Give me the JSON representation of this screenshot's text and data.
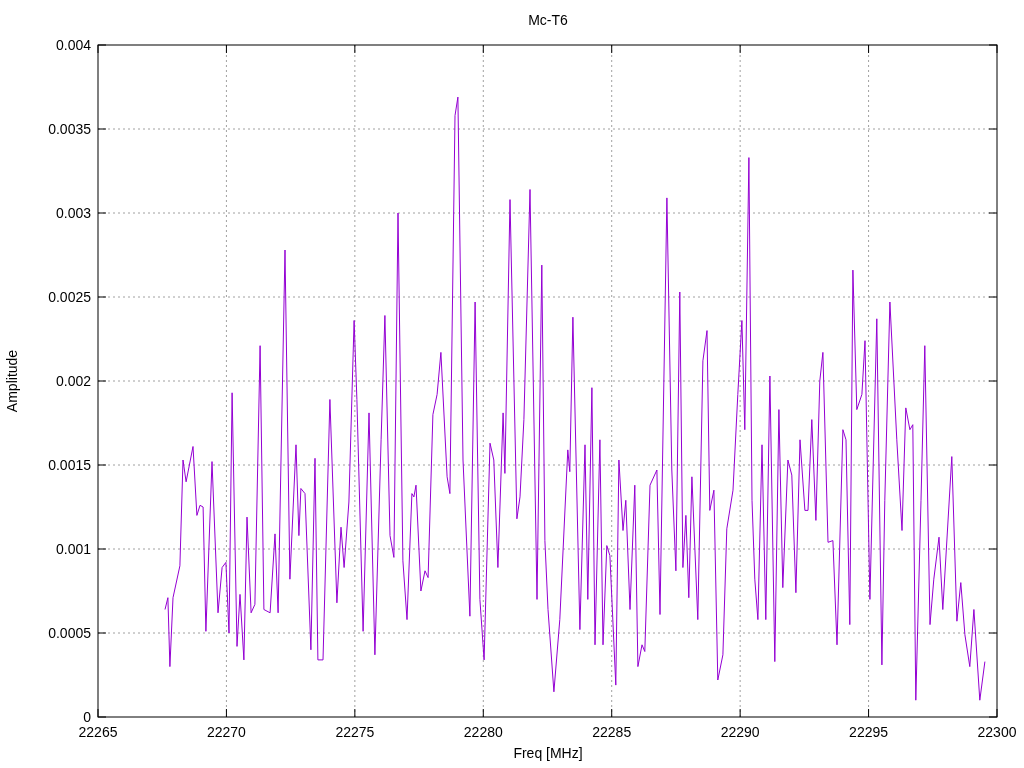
{
  "chart_data": {
    "type": "line",
    "grid": true,
    "title": "Mc-T6",
    "xlabel": "Freq [MHz]",
    "ylabel": "Amplitude",
    "xlim": [
      22265,
      22300
    ],
    "ylim": [
      0,
      0.004
    ],
    "xticks": [
      22265,
      22270,
      22275,
      22280,
      22285,
      22290,
      22295,
      22300
    ],
    "yticks": [
      0,
      0.0005,
      0.001,
      0.0015,
      0.002,
      0.0025,
      0.003,
      0.0035,
      0.004
    ],
    "x": [
      22267.61,
      22267.72,
      22267.8,
      22267.92,
      22268.19,
      22268.31,
      22268.43,
      22268.7,
      22268.85,
      22268.97,
      22269.09,
      22269.2,
      22269.44,
      22269.67,
      22269.83,
      22269.98,
      22270.1,
      22270.22,
      22270.41,
      22270.53,
      22270.68,
      22270.8,
      22270.96,
      22271.11,
      22271.31,
      22271.46,
      22271.7,
      22271.89,
      22272.01,
      22272.28,
      22272.47,
      22272.71,
      22272.82,
      22272.9,
      22273.06,
      22273.29,
      22273.45,
      22273.56,
      22273.76,
      22274.03,
      22274.3,
      22274.46,
      22274.58,
      22274.77,
      22274.97,
      22275.08,
      22275.32,
      22275.55,
      22275.78,
      22276.02,
      22276.17,
      22276.37,
      22276.52,
      22276.68,
      22276.87,
      22277.03,
      22277.22,
      22277.3,
      22277.38,
      22277.57,
      22277.73,
      22277.85,
      22278.04,
      22278.2,
      22278.35,
      22278.59,
      22278.7,
      22278.9,
      22279.01,
      22279.21,
      22279.48,
      22279.68,
      22279.87,
      22280.03,
      22280.26,
      22280.41,
      22280.57,
      22280.77,
      22280.84,
      22281.04,
      22281.31,
      22281.43,
      22281.58,
      22281.82,
      22282.09,
      22282.28,
      22282.4,
      22282.52,
      22282.75,
      22282.98,
      22283.29,
      22283.37,
      22283.49,
      22283.76,
      22283.96,
      22284.07,
      22284.23,
      22284.35,
      22284.54,
      22284.66,
      22284.81,
      22284.93,
      22285.16,
      22285.28,
      22285.44,
      22285.55,
      22285.71,
      22285.9,
      22286.02,
      22286.18,
      22286.29,
      22286.49,
      22286.76,
      22286.88,
      22287.15,
      22287.34,
      22287.5,
      22287.65,
      22287.77,
      22287.89,
      22288.0,
      22288.12,
      22288.35,
      22288.55,
      22288.71,
      22288.82,
      22288.98,
      22289.13,
      22289.33,
      22289.48,
      22289.72,
      22289.91,
      22290.07,
      22290.18,
      22290.34,
      22290.46,
      22290.57,
      22290.69,
      22290.85,
      22291.0,
      22291.16,
      22291.35,
      22291.51,
      22291.66,
      22291.86,
      22292.01,
      22292.17,
      22292.33,
      22292.52,
      22292.64,
      22292.79,
      22292.95,
      22293.1,
      22293.22,
      22293.42,
      22293.61,
      22293.77,
      22294.0,
      22294.12,
      22294.27,
      22294.39,
      22294.54,
      22294.74,
      22294.86,
      22295.05,
      22295.32,
      22295.52,
      22295.63,
      22295.83,
      22296.1,
      22296.3,
      22296.45,
      22296.61,
      22296.72,
      22296.84,
      22297.04,
      22297.19,
      22297.39,
      22297.54,
      22297.74,
      22297.89,
      22298.24,
      22298.44,
      22298.59,
      22298.75,
      22298.94,
      22299.1,
      22299.33,
      22299.53
    ],
    "series": [
      {
        "color": "#9400d3",
        "values": [
          0.00064,
          0.00071,
          0.0003,
          0.00071,
          0.0009,
          0.00153,
          0.0014,
          0.00161,
          0.0012,
          0.00126,
          0.00125,
          0.00051,
          0.00152,
          0.00062,
          0.00089,
          0.00092,
          0.0005,
          0.00193,
          0.00042,
          0.00073,
          0.00034,
          0.00119,
          0.00062,
          0.00067,
          0.00221,
          0.00064,
          0.00062,
          0.00109,
          0.00062,
          0.00278,
          0.00082,
          0.00162,
          0.00108,
          0.00136,
          0.00133,
          0.0004,
          0.00154,
          0.00034,
          0.00034,
          0.00189,
          0.00068,
          0.00113,
          0.00089,
          0.00128,
          0.00236,
          0.00189,
          0.00051,
          0.00181,
          0.00037,
          0.00165,
          0.00239,
          0.00108,
          0.00095,
          0.003,
          0.00093,
          0.00058,
          0.00133,
          0.00131,
          0.00138,
          0.00075,
          0.00087,
          0.00083,
          0.0018,
          0.00192,
          0.00217,
          0.00143,
          0.00133,
          0.00358,
          0.00369,
          0.00153,
          0.0006,
          0.00247,
          0.0007,
          0.00034,
          0.00163,
          0.00153,
          0.00089,
          0.00181,
          0.00145,
          0.00308,
          0.00118,
          0.00131,
          0.00177,
          0.00314,
          0.0007,
          0.00269,
          0.00105,
          0.00064,
          0.00015,
          0.00058,
          0.00159,
          0.00146,
          0.00238,
          0.00052,
          0.00162,
          0.0007,
          0.00196,
          0.00043,
          0.00165,
          0.00043,
          0.00102,
          0.00096,
          0.00019,
          0.00153,
          0.00111,
          0.00129,
          0.00064,
          0.00138,
          0.0003,
          0.00043,
          0.00039,
          0.00138,
          0.00147,
          0.00061,
          0.00309,
          0.00147,
          0.00087,
          0.00253,
          0.00089,
          0.0012,
          0.00071,
          0.00143,
          0.00058,
          0.00212,
          0.0023,
          0.00123,
          0.00135,
          0.00022,
          0.00037,
          0.00112,
          0.00135,
          0.00192,
          0.00236,
          0.00171,
          0.00333,
          0.00129,
          0.00082,
          0.00058,
          0.00162,
          0.00058,
          0.00203,
          0.00033,
          0.00183,
          0.00077,
          0.00153,
          0.00144,
          0.00074,
          0.00165,
          0.00123,
          0.00123,
          0.00177,
          0.00117,
          0.002,
          0.00217,
          0.00104,
          0.00105,
          0.00043,
          0.00171,
          0.00165,
          0.00055,
          0.00266,
          0.00183,
          0.00192,
          0.00224,
          0.0007,
          0.00237,
          0.00031,
          0.00129,
          0.00247,
          0.00165,
          0.00111,
          0.00184,
          0.00171,
          0.00174,
          0.0001,
          0.00129,
          0.00221,
          0.00055,
          0.00082,
          0.00107,
          0.00064,
          0.00155,
          0.00057,
          0.0008,
          0.00049,
          0.0003,
          0.00064,
          0.0001,
          0.00033
        ]
      }
    ]
  }
}
